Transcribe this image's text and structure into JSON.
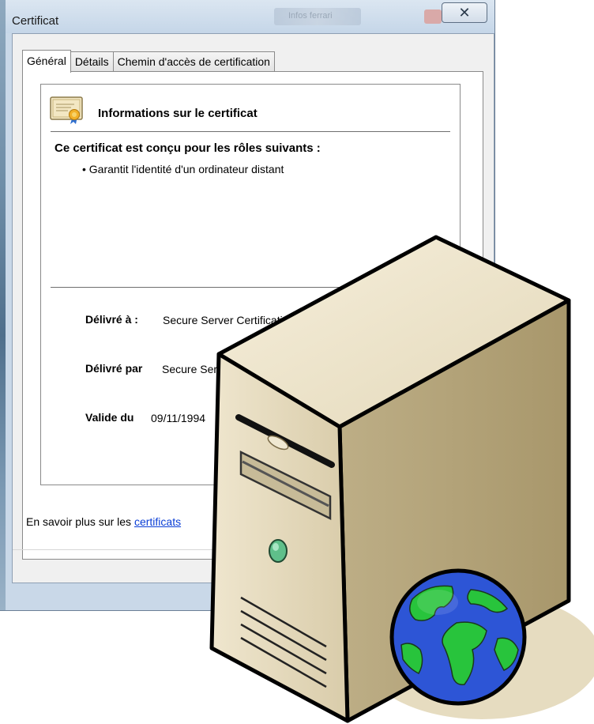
{
  "window": {
    "title": "Certificat",
    "blurred_title": "Infos ferrari",
    "close_glyph": "✕"
  },
  "tabs": [
    {
      "label": "Général",
      "active": true
    },
    {
      "label": "Détails",
      "active": false
    },
    {
      "label": "Chemin d'accès de certification",
      "active": false
    }
  ],
  "certificate": {
    "info_title": "Informations sur le certificat",
    "purpose_title": "Ce certificat est conçu pour les rôles suivants :",
    "purposes": [
      "• Garantit l'identité d'un ordinateur distant"
    ],
    "issued_to_label": "Délivré à :",
    "issued_to_value": "Secure Server Certificatio",
    "issued_by_label": "Délivré par",
    "issued_by_value": "Secure Ser",
    "valid_from_label": "Valide du",
    "valid_from_value": "09/11/1994"
  },
  "footer": {
    "learn_prefix": "En savoir plus sur les ",
    "learn_link": "certificats"
  },
  "colors": {
    "link": "#0a3ed6",
    "server_body": "#d6cbb0",
    "globe_ocean": "#2d55d6",
    "globe_land": "#28c43c"
  },
  "icons": {
    "certificate": "certificate-icon",
    "server": "server-icon",
    "globe": "globe-icon"
  }
}
